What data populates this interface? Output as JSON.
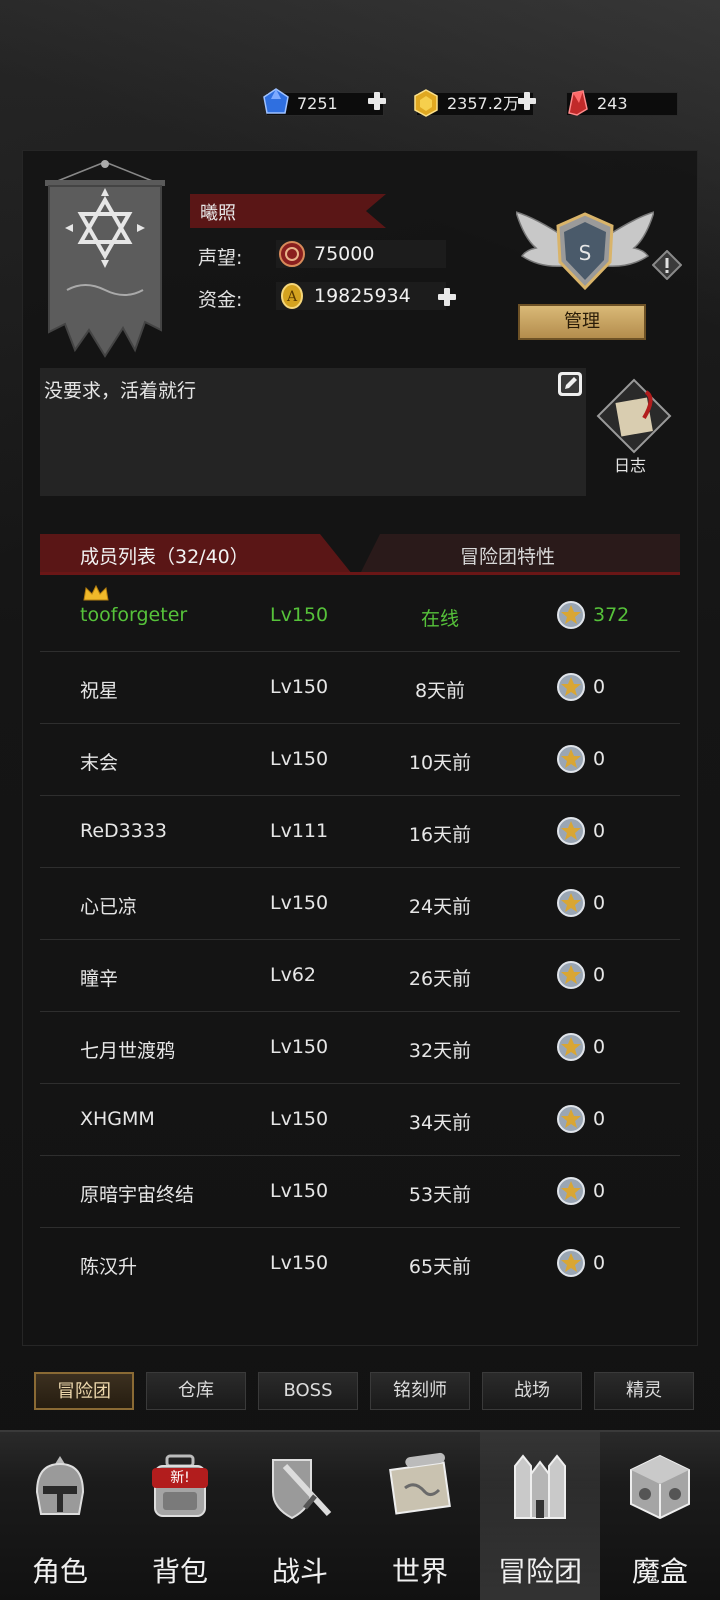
{
  "currency": {
    "gems": "7251",
    "gold": "2357.2万",
    "ruby": "243"
  },
  "guild": {
    "name": "曦照",
    "reputation_label": "声望:",
    "reputation_value": "75000",
    "funds_label": "资金:",
    "funds_value": "19825934",
    "rank": "S",
    "manage_label": "管理",
    "motto": "没要求，活着就行",
    "log_label": "日志"
  },
  "tabs": {
    "members": "成员列表（32/40）",
    "traits": "冒险团特性"
  },
  "members": [
    {
      "name": "tooforgeter",
      "level": "Lv150",
      "last_seen": "在线",
      "points": "372"
    },
    {
      "name": "祝星",
      "level": "Lv150",
      "last_seen": "8天前",
      "points": "0"
    },
    {
      "name": "末会",
      "level": "Lv150",
      "last_seen": "10天前",
      "points": "0"
    },
    {
      "name": "ReD3333",
      "level": "Lv111",
      "last_seen": "16天前",
      "points": "0"
    },
    {
      "name": "心已凉",
      "level": "Lv150",
      "last_seen": "24天前",
      "points": "0"
    },
    {
      "name": "瞳辛",
      "level": "Lv62",
      "last_seen": "26天前",
      "points": "0"
    },
    {
      "name": "七月世渡鸦",
      "level": "Lv150",
      "last_seen": "32天前",
      "points": "0"
    },
    {
      "name": "XHGMM",
      "level": "Lv150",
      "last_seen": "34天前",
      "points": "0"
    },
    {
      "name": "原暗宇宙终结",
      "level": "Lv150",
      "last_seen": "53天前",
      "points": "0"
    },
    {
      "name": "陈汉升",
      "level": "Lv150",
      "last_seen": "65天前",
      "points": "0"
    }
  ],
  "subnav": [
    "冒险团",
    "仓库",
    "BOSS",
    "铭刻师",
    "战场",
    "精灵"
  ],
  "bottomnav": [
    "角色",
    "背包",
    "战斗",
    "世界",
    "冒险团",
    "魔盒"
  ],
  "new_badge": "新!",
  "colors": {
    "online_green": "#56c23a",
    "accent_red": "#7a1818",
    "gold_button": "#c9a562"
  }
}
